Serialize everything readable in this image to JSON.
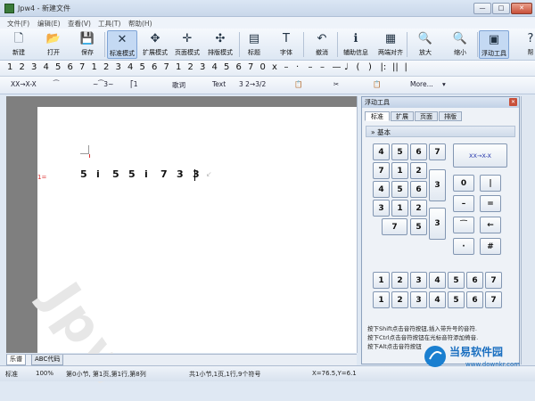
{
  "window": {
    "title": "Jpw4 - 新建文件",
    "min": "—",
    "max": "□",
    "close": "✕"
  },
  "menu": [
    "文件(F)",
    "编辑(E)",
    "查看(V)",
    "工具(T)",
    "帮助(H)"
  ],
  "toolbar": [
    {
      "label": "新建",
      "icon": "new-file-icon",
      "glyph": "🗋"
    },
    {
      "label": "打开",
      "icon": "open-folder-icon",
      "glyph": "📂"
    },
    {
      "label": "保存",
      "icon": "save-disk-icon",
      "glyph": "💾"
    },
    {
      "label": "标准模式",
      "icon": "standard-mode-icon",
      "glyph": "✕"
    },
    {
      "label": "扩展模式",
      "icon": "extend-mode-icon",
      "glyph": "✥"
    },
    {
      "label": "页面模式",
      "icon": "page-mode-icon",
      "glyph": "✛"
    },
    {
      "label": "排版模式",
      "icon": "layout-mode-icon",
      "glyph": "✣"
    },
    {
      "label": "标题",
      "icon": "title-icon",
      "glyph": "▤"
    },
    {
      "label": "字体",
      "icon": "font-icon",
      "glyph": "T"
    },
    {
      "label": "撤消",
      "icon": "undo-icon",
      "glyph": "↶"
    },
    {
      "label": "辅助信息",
      "icon": "aux-info-icon",
      "glyph": "ℹ"
    },
    {
      "label": "两端对齐",
      "icon": "justify-icon",
      "glyph": "▦"
    },
    {
      "label": "放大",
      "icon": "zoom-in-icon",
      "glyph": "🔍"
    },
    {
      "label": "缩小",
      "icon": "zoom-out-icon",
      "glyph": "🔍"
    },
    {
      "label": "浮动工具",
      "icon": "float-tool-icon",
      "glyph": "▣"
    },
    {
      "label": "帮",
      "icon": "help-icon",
      "glyph": "?"
    }
  ],
  "notebar": [
    "1",
    "2",
    "3",
    "4",
    "5",
    "6",
    "7",
    "1",
    "2",
    "3",
    "4",
    "5",
    "6",
    "7",
    "1",
    "2",
    "3",
    "4",
    "5",
    "6",
    "7",
    "0",
    "x",
    "–",
    "·",
    "–",
    "–",
    "—",
    "♩",
    "(",
    ")",
    "|:",
    "||",
    "|"
  ],
  "symbar": [
    "XX→X-X",
    "⁀",
    "~⁀3~",
    "⎡1",
    "歌词",
    "Text",
    "3 2→3/2",
    "📋",
    "✂",
    "📋",
    "More...",
    "▾"
  ],
  "score": {
    "key_label": "1=",
    "notes": [
      "5",
      "i",
      "5",
      "5",
      "i",
      "7",
      "3",
      "3"
    ]
  },
  "watermark": "Jpw",
  "bottom_tabs": [
    "乐谱",
    "ABC代码"
  ],
  "status": {
    "mode": "标准",
    "zoom": "100%",
    "position": "第0小节, 第1页,第1行,第8列",
    "summary": "共1小节,1页,1行,9个符号",
    "coords": "X=76.5,Y=6.1"
  },
  "panel": {
    "title": "浮动工具",
    "tabs": [
      "标准",
      "扩展",
      "页面",
      "排版"
    ],
    "section": "基本",
    "keypad": [
      "4",
      "5",
      "6",
      "7",
      "7",
      "1",
      "2",
      "3",
      "4",
      "5",
      "6",
      "3",
      "1",
      "2",
      "3",
      "7",
      "5",
      "6"
    ],
    "right_keys": [
      "XX→X-X",
      "0",
      "|",
      "–",
      "=",
      "⁀",
      "←",
      "·",
      "#"
    ],
    "octave_row1": [
      "1",
      "2",
      "3",
      "4",
      "5",
      "6",
      "7"
    ],
    "octave_row2": [
      "1",
      "2",
      "3",
      "4",
      "5",
      "6",
      "7"
    ],
    "help": [
      "按下Shift点击音符按钮,插入带升号的音符.",
      "按下Ctrl点击音符按钮在光标音符添加倚音.",
      "按下Alt点击音符按钮"
    ]
  },
  "logo": {
    "cn": "当易软件园",
    "url": "www.downkr.com"
  }
}
